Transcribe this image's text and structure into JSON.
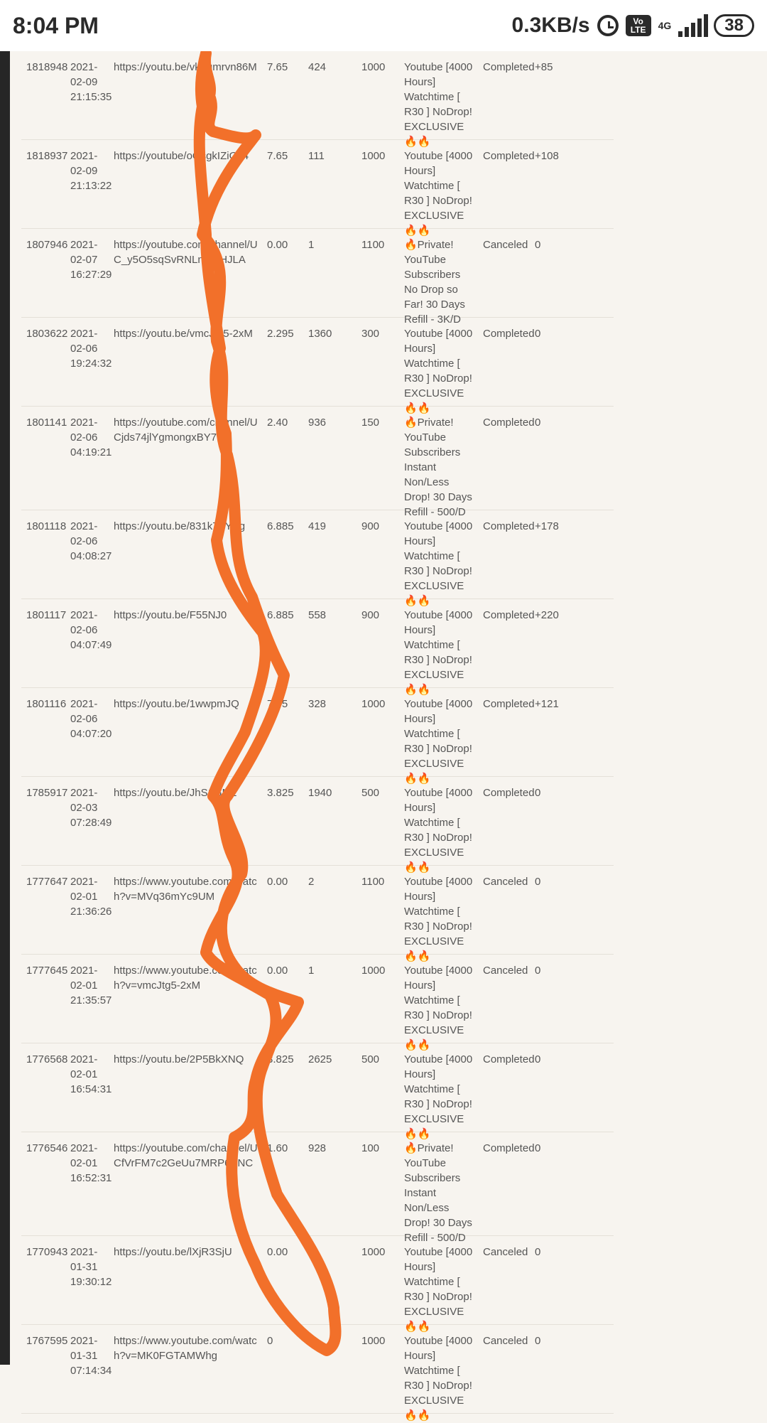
{
  "status_bar": {
    "time": "8:04 PM",
    "net_speed": "0.3KB/s",
    "volte": "Vo LTE",
    "network": "4G",
    "battery": "38"
  },
  "orders": [
    {
      "id": "1818948",
      "date": "2021-02-09",
      "time": "21:15:35",
      "link": "https://youtu.be/vkTgmrvn86M",
      "charge": "7.65",
      "start": "424",
      "quantity": "1000",
      "service": "Youtube [4000 Hours] Watchtime [ R30 ] NoDrop! EXCLUSIVE 🔥🔥",
      "status": "Completed",
      "remains": "+85"
    },
    {
      "id": "1818937",
      "date": "2021-02-09",
      "time": "21:13:22",
      "link": "https://youtube/oOsgkIZiGJ4",
      "charge": "7.65",
      "start": "111",
      "quantity": "1000",
      "service": "Youtube [4000 Hours] Watchtime [ R30 ] NoDrop! EXCLUSIVE 🔥🔥",
      "status": "Completed",
      "remains": "+108"
    },
    {
      "id": "1807946",
      "date": "2021-02-07",
      "time": "16:27:29",
      "link": "https://youtube.com/channel/UC_y5O5sqSvRNLmpSHJLA",
      "charge": "0.00",
      "start": "1",
      "quantity": "1100",
      "service": "🔥Private! YouTube Subscribers No Drop so Far! 30 Days Refill - 3K/D",
      "status": "Canceled",
      "remains": "0"
    },
    {
      "id": "1803622",
      "date": "2021-02-06",
      "time": "19:24:32",
      "link": "https://youtu.be/vmcJtg5-2xM",
      "charge": "2.295",
      "start": "1360",
      "quantity": "300",
      "service": "Youtube [4000 Hours] Watchtime [ R30 ] NoDrop! EXCLUSIVE 🔥🔥",
      "status": "Completed",
      "remains": "0"
    },
    {
      "id": "1801141",
      "date": "2021-02-06",
      "time": "04:19:21",
      "link": "https://youtube.com/channel/UCjds74jlYgmongxBY7Q",
      "charge": "2.40",
      "start": "936",
      "quantity": "150",
      "service": "🔥Private! YouTube Subscribers Instant Non/Less Drop! 30 Days Refill - 500/D",
      "status": "Completed",
      "remains": "0"
    },
    {
      "id": "1801118",
      "date": "2021-02-06",
      "time": "04:08:27",
      "link": "https://youtu.be/831k7TYEg",
      "charge": "6.885",
      "start": "419",
      "quantity": "900",
      "service": "Youtube [4000 Hours] Watchtime [ R30 ] NoDrop! EXCLUSIVE 🔥🔥",
      "status": "Completed",
      "remains": "+178"
    },
    {
      "id": "1801117",
      "date": "2021-02-06",
      "time": "04:07:49",
      "link": "https://youtu.be/F55NJ0",
      "charge": "6.885",
      "start": "558",
      "quantity": "900",
      "service": "Youtube [4000 Hours] Watchtime [ R30 ] NoDrop! EXCLUSIVE 🔥🔥",
      "status": "Completed",
      "remains": "+220"
    },
    {
      "id": "1801116",
      "date": "2021-02-06",
      "time": "04:07:20",
      "link": "https://youtu.be/1wwpmJQ",
      "charge": "7.65",
      "start": "328",
      "quantity": "1000",
      "service": "Youtube [4000 Hours] Watchtime [ R30 ] NoDrop! EXCLUSIVE 🔥🔥",
      "status": "Completed",
      "remains": "+121"
    },
    {
      "id": "1785917",
      "date": "2021-02-03",
      "time": "07:28:49",
      "link": "https://youtu.be/JhS1GNE",
      "charge": "3.825",
      "start": "1940",
      "quantity": "500",
      "service": "Youtube [4000 Hours] Watchtime [ R30 ] NoDrop! EXCLUSIVE 🔥🔥",
      "status": "Completed",
      "remains": "0"
    },
    {
      "id": "1777647",
      "date": "2021-02-01",
      "time": "21:36:26",
      "link": "https://www.youtube.com/watch?v=MVq36mYc9UM",
      "charge": "0.00",
      "start": "2",
      "quantity": "1100",
      "service": "Youtube [4000 Hours] Watchtime [ R30 ] NoDrop! EXCLUSIVE 🔥🔥",
      "status": "Canceled",
      "remains": "0"
    },
    {
      "id": "1777645",
      "date": "2021-02-01",
      "time": "21:35:57",
      "link": "https://www.youtube.com/watch?v=vmcJtg5-2xM",
      "charge": "0.00",
      "start": "1",
      "quantity": "1000",
      "service": "Youtube [4000 Hours] Watchtime [ R30 ] NoDrop! EXCLUSIVE 🔥🔥",
      "status": "Canceled",
      "remains": "0"
    },
    {
      "id": "1776568",
      "date": "2021-02-01",
      "time": "16:54:31",
      "link": "https://youtu.be/2P5BkXNQ",
      "charge": "3.825",
      "start": "2625",
      "quantity": "500",
      "service": "Youtube [4000 Hours] Watchtime [ R30 ] NoDrop! EXCLUSIVE 🔥🔥",
      "status": "Completed",
      "remains": "0"
    },
    {
      "id": "1776546",
      "date": "2021-02-01",
      "time": "16:52:31",
      "link": "https://youtube.com/channel/UCfVrFM7c2GeUu7MRP6BNC",
      "charge": "1.60",
      "start": "928",
      "quantity": "100",
      "service": "🔥Private! YouTube Subscribers Instant Non/Less Drop! 30 Days Refill - 500/D",
      "status": "Completed",
      "remains": "0"
    },
    {
      "id": "1770943",
      "date": "2021-01-31",
      "time": "19:30:12",
      "link": "https://youtu.be/lXjR3SjU",
      "charge": "0.00",
      "start": "2",
      "quantity": "1000",
      "service": "Youtube [4000 Hours] Watchtime [ R30 ] NoDrop! EXCLUSIVE 🔥🔥",
      "status": "Canceled",
      "remains": "0"
    },
    {
      "id": "1767595",
      "date": "2021-01-31",
      "time": "07:14:34",
      "link": "https://www.youtube.com/watch?v=MK0FGTAMWhg",
      "charge": "0",
      "start": "0",
      "quantity": "1000",
      "service": "Youtube [4000 Hours] Watchtime [ R30 ] NoDrop! EXCLUSIVE 🔥🔥",
      "status": "Canceled",
      "remains": "0"
    }
  ]
}
